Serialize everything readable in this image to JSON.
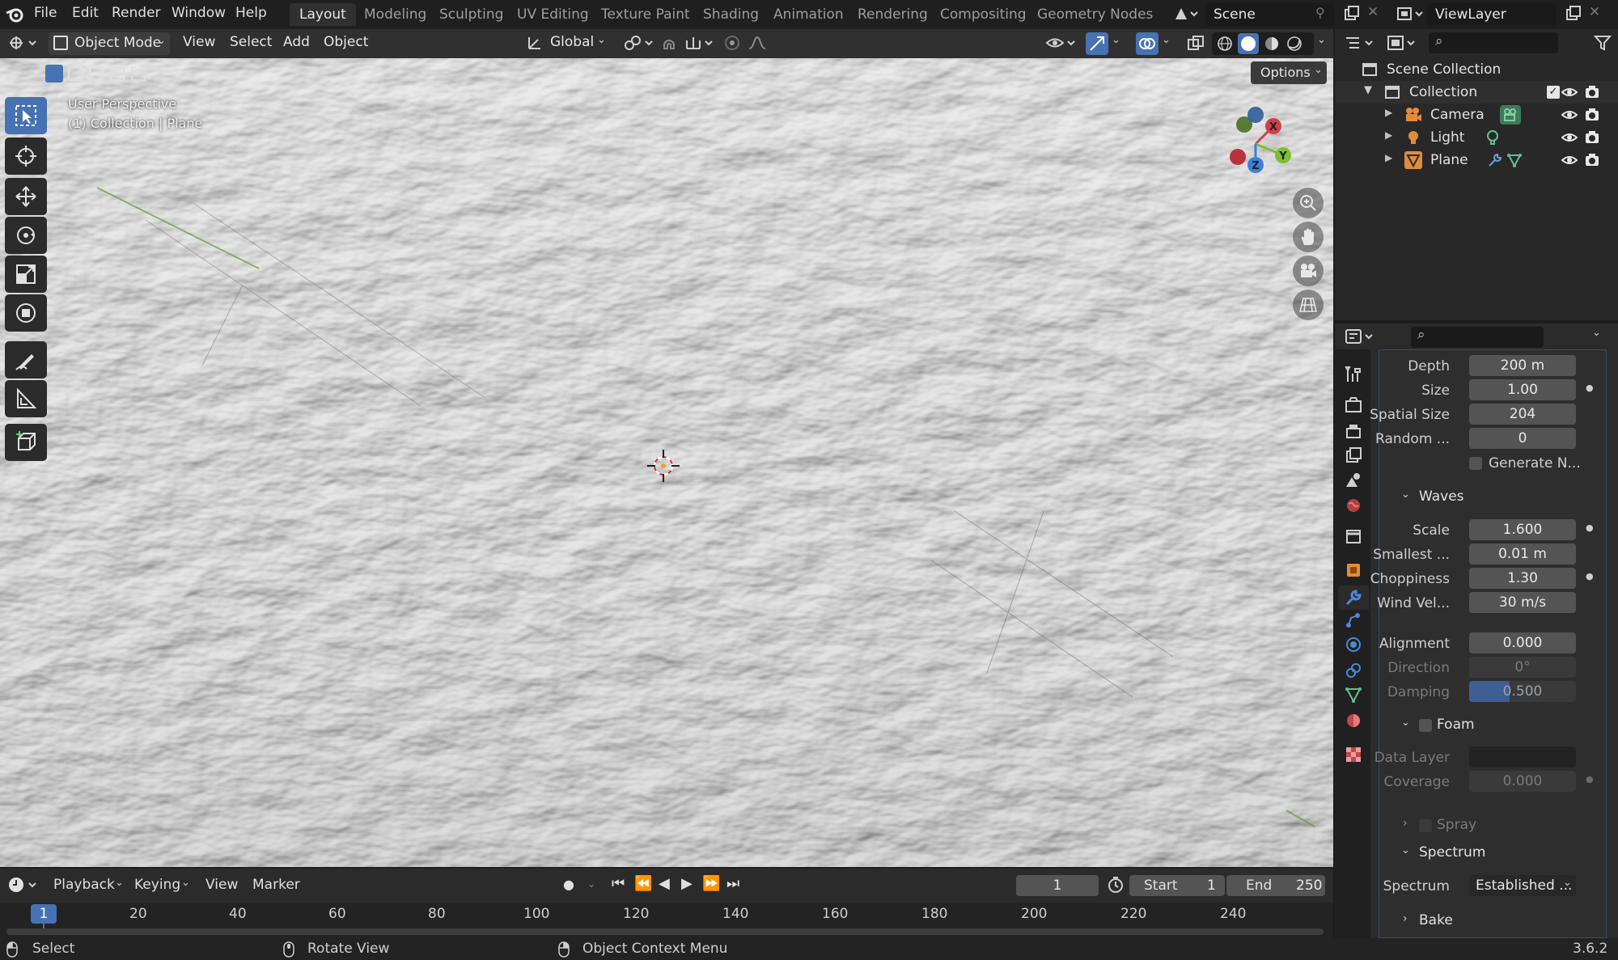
{
  "menu": [
    "File",
    "Edit",
    "Render",
    "Window",
    "Help"
  ],
  "workspaces": [
    "Layout",
    "Modeling",
    "Sculpting",
    "UV Editing",
    "Texture Paint",
    "Shading",
    "Animation",
    "Rendering",
    "Compositing",
    "Geometry Nodes"
  ],
  "scene": "Scene",
  "view_layer": "ViewLayer",
  "header": {
    "mode": "Object Mode",
    "view": "View",
    "select": "Select",
    "add": "Add",
    "object": "Object",
    "transform": "Global",
    "options": "Options"
  },
  "viewport": {
    "perspective": "User Perspective",
    "context": "(1) Collection | Plane",
    "axis_x": "X",
    "axis_y": "Y",
    "axis_z": "Z"
  },
  "outliner": {
    "root": "Scene Collection",
    "collection": "Collection",
    "items": [
      "Camera",
      "Light",
      "Plane"
    ]
  },
  "properties": {
    "depth_label": "Depth",
    "depth": "200 m",
    "size_label": "Size",
    "size": "1.00",
    "spatial_label": "Spatial Size",
    "spatial": "204",
    "random_label": "Random ...",
    "random": "0",
    "generate_label": "Generate N...",
    "waves_section": "Waves",
    "scale_label": "Scale",
    "scale": "1.600",
    "smallest_label": "Smallest ...",
    "smallest": "0.01 m",
    "chop_label": "Choppiness",
    "chop": "1.30",
    "wind_label": "Wind Vel...",
    "wind": "30 m/s",
    "align_label": "Alignment",
    "align": "0.000",
    "direction_label": "Direction",
    "direction": "0°",
    "damping_label": "Damping",
    "damping": "0.500",
    "damping_fill": 0.38,
    "foam_section": "Foam",
    "datalayer_label": "Data Layer",
    "coverage_label": "Coverage",
    "coverage": "0.000",
    "spray_section": "Spray",
    "spectrum_section": "Spectrum",
    "spectrum_label": "Spectrum",
    "spectrum": "Established ...",
    "bake_section": "Bake"
  },
  "timeline": {
    "playback": "Playback",
    "keying": "Keying",
    "view": "View",
    "marker": "Marker",
    "frame": "1",
    "start_label": "Start",
    "start": "1",
    "end_label": "End",
    "end": "250",
    "current": "1",
    "ticks": [
      "20",
      "40",
      "60",
      "80",
      "100",
      "120",
      "140",
      "160",
      "180",
      "200",
      "220",
      "240"
    ]
  },
  "status": {
    "select": "Select",
    "rotate": "Rotate View",
    "context": "Object Context Menu",
    "version": "3.6.2"
  }
}
